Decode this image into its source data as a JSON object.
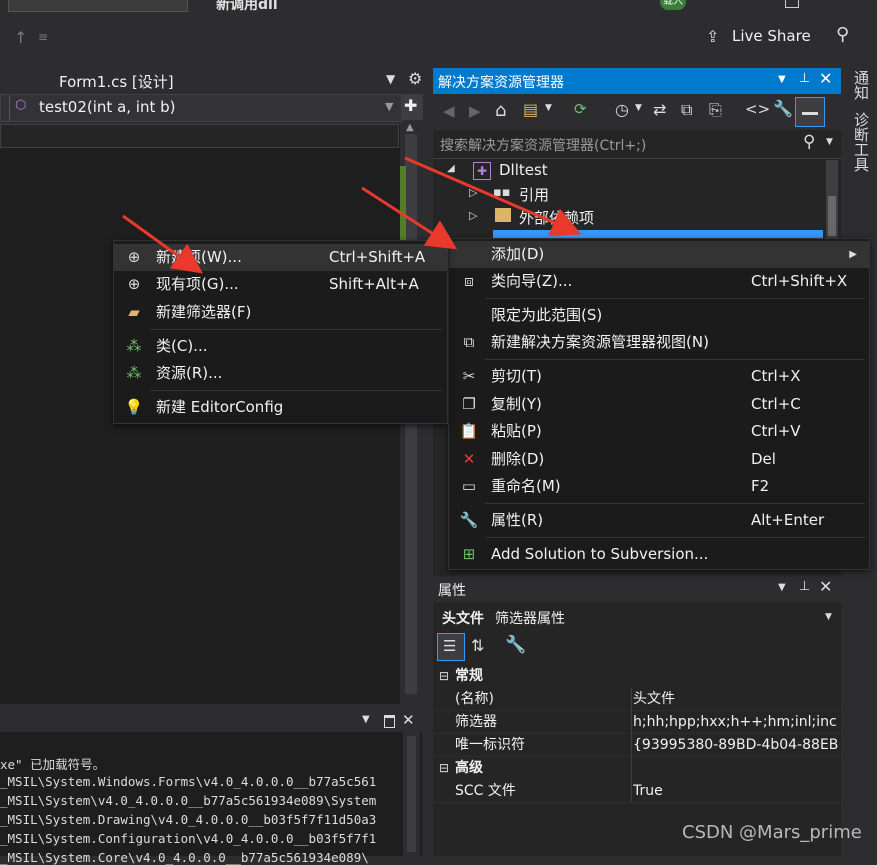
{
  "window": {
    "title_partial": "新调用dll",
    "badge": "载入",
    "live_share": "Live Share"
  },
  "editor": {
    "tab_title": "Form1.cs [设计]",
    "member_dropdown": "test02(int a, int b)"
  },
  "solution_explorer": {
    "title": "解决方案资源管理器",
    "search_placeholder": "搜索解决方案资源管理器(Ctrl+;)",
    "tree": [
      {
        "label": "Dlltest"
      },
      {
        "label": "引用"
      },
      {
        "label": "外部依赖项"
      }
    ]
  },
  "vertical_tabs": [
    "通知",
    "诊断工具"
  ],
  "submenu_add": {
    "items": [
      {
        "label": "新建项(W)...",
        "shortcut": "Ctrl+Shift+A"
      },
      {
        "label": "现有项(G)...",
        "shortcut": "Shift+Alt+A"
      },
      {
        "label": "新建筛选器(F)",
        "shortcut": ""
      },
      {
        "label": "类(C)...",
        "shortcut": ""
      },
      {
        "label": "资源(R)...",
        "shortcut": ""
      },
      {
        "label": "新建 EditorConfig",
        "shortcut": ""
      }
    ]
  },
  "context_menu": {
    "items": [
      {
        "label": "添加(D)",
        "shortcut": ""
      },
      {
        "label": "类向导(Z)...",
        "shortcut": "Ctrl+Shift+X"
      },
      {
        "label": "限定为此范围(S)",
        "shortcut": ""
      },
      {
        "label": "新建解决方案资源管理器视图(N)",
        "shortcut": ""
      },
      {
        "label": "剪切(T)",
        "shortcut": "Ctrl+X"
      },
      {
        "label": "复制(Y)",
        "shortcut": "Ctrl+C"
      },
      {
        "label": "粘贴(P)",
        "shortcut": "Ctrl+V"
      },
      {
        "label": "删除(D)",
        "shortcut": "Del"
      },
      {
        "label": "重命名(M)",
        "shortcut": "F2"
      },
      {
        "label": "属性(R)",
        "shortcut": "Alt+Enter"
      },
      {
        "label": "Add Solution to Subversion...",
        "shortcut": ""
      }
    ]
  },
  "properties": {
    "title": "属性",
    "object_name": "头文件",
    "object_type": "筛选器属性",
    "categories": [
      {
        "name": "常规",
        "rows": [
          {
            "name": "(名称)",
            "value": "头文件"
          },
          {
            "name": "筛选器",
            "value": "h;hh;hpp;hxx;h++;hm;inl;inc;i"
          },
          {
            "name": "唯一标识符",
            "value": "{93995380-89BD-4b04-88EB-"
          }
        ]
      },
      {
        "name": "高级",
        "rows": [
          {
            "name": "SCC 文件",
            "value": "True"
          }
        ]
      }
    ]
  },
  "output": {
    "lines": [
      "xe\" 已加载符号。",
      "_MSIL\\System.Windows.Forms\\v4.0_4.0.0.0__b77a5c561",
      "_MSIL\\System\\v4.0_4.0.0.0__b77a5c561934e089\\System",
      "_MSIL\\System.Drawing\\v4.0_4.0.0.0__b03f5f7f11d50a3",
      "_MSIL\\System.Configuration\\v4.0_4.0.0.0__b03f5f7f1",
      "_MSIL\\System.Core\\v4.0_4.0.0.0__b77a5c561934e089\\"
    ]
  },
  "watermark": "CSDN @Mars_prime",
  "colors": {
    "accent": "#007acc",
    "menu_bg": "#1b1b1c",
    "highlight": "#333334",
    "arrow": "#e8392c"
  }
}
